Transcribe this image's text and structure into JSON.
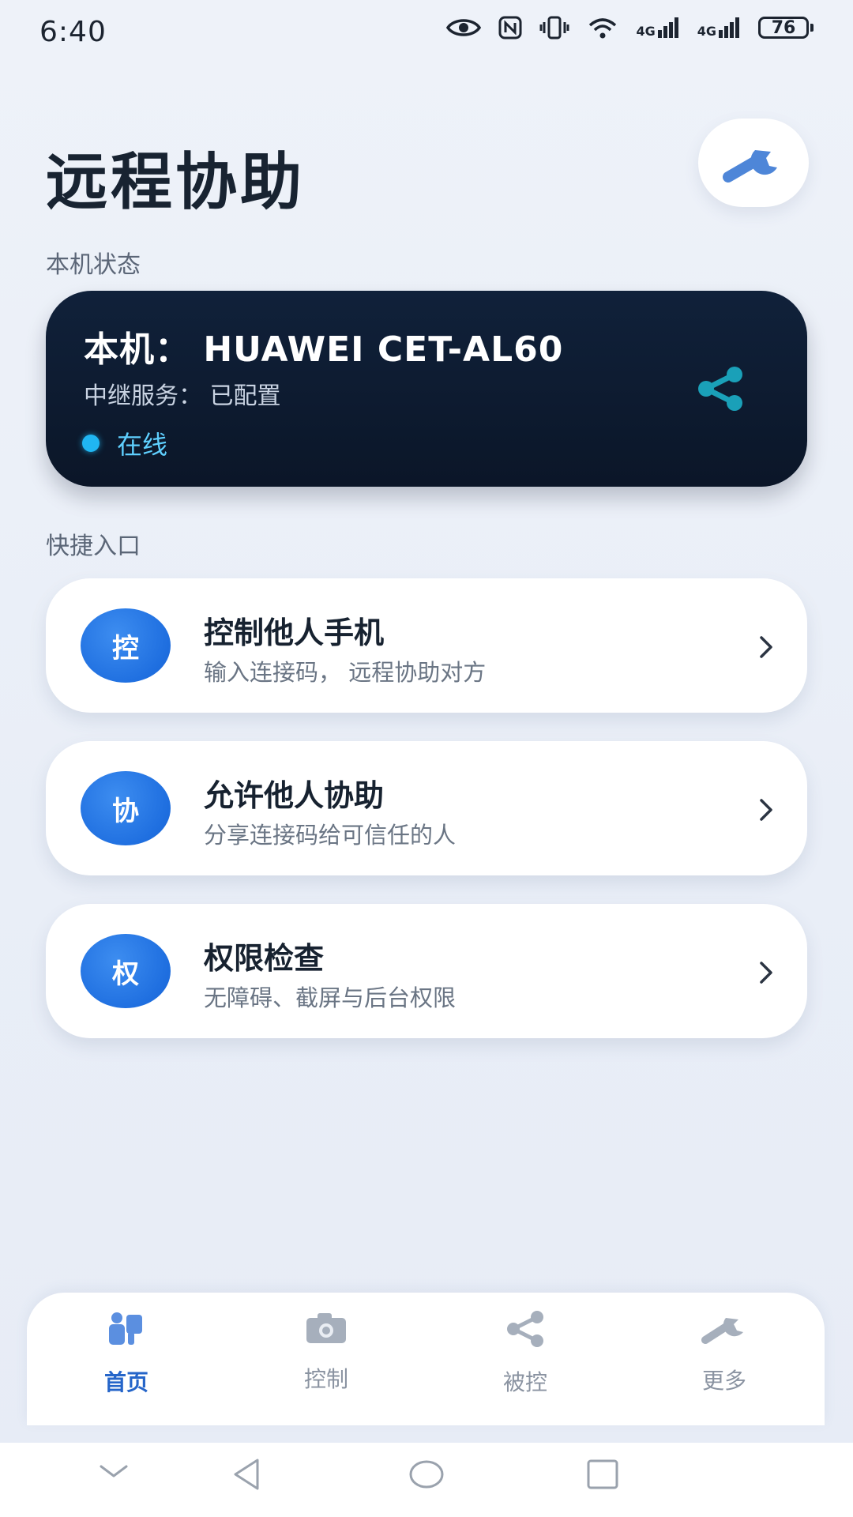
{
  "status_bar": {
    "time": "6:40",
    "battery": "76",
    "net_label_1": "4G",
    "net_label_2": "4G"
  },
  "page": {
    "title": "远程协助"
  },
  "device_section": {
    "label": "本机状态",
    "device_name": "本机： HUAWEI CET-AL60",
    "relay_text": "中继服务： 已配置",
    "status_text": "在线"
  },
  "quick_section": {
    "label": "快捷入口",
    "items": [
      {
        "icon_text": "控",
        "title": "控制他人手机",
        "subtitle": "输入连接码， 远程协助对方"
      },
      {
        "icon_text": "协",
        "title": "允许他人协助",
        "subtitle": "分享连接码给可信任的人"
      },
      {
        "icon_text": "权",
        "title": "权限检查",
        "subtitle": "无障碍、截屏与后台权限"
      }
    ]
  },
  "bottom_nav": {
    "items": [
      {
        "label": "首页",
        "icon": "home-icon",
        "active": true
      },
      {
        "label": "控制",
        "icon": "camera-icon",
        "active": false
      },
      {
        "label": "被控",
        "icon": "share-icon",
        "active": false
      },
      {
        "label": "更多",
        "icon": "wrench-icon",
        "active": false
      }
    ]
  },
  "colors": {
    "accent": "#2565c9",
    "card_dark": "#0b1628",
    "online": "#20b6f2",
    "share_teal": "#1aa0b8"
  }
}
